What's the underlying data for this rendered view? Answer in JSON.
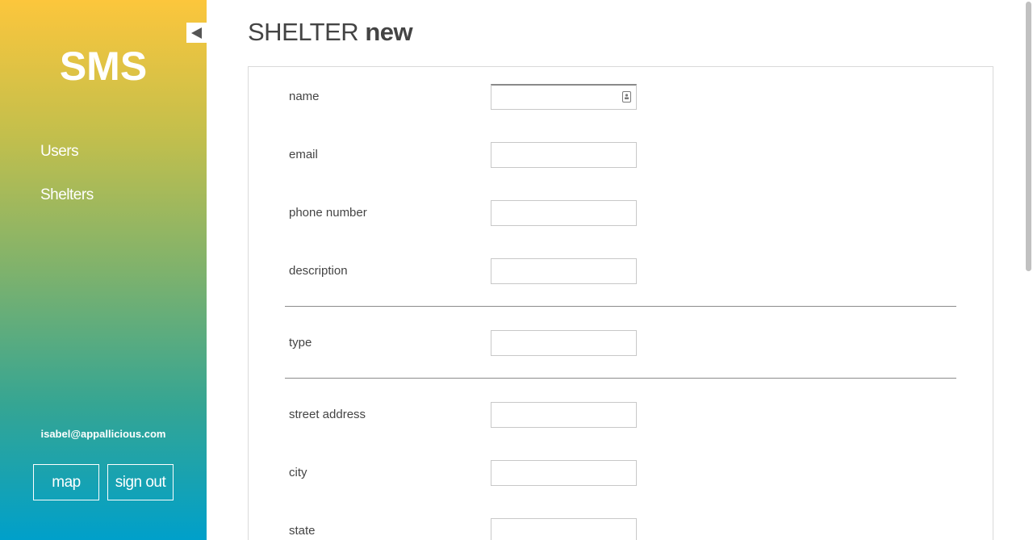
{
  "sidebar": {
    "brand": "SMS",
    "nav": [
      {
        "label": "Users"
      },
      {
        "label": "Shelters"
      }
    ],
    "user_email": "isabel@appallicious.com",
    "buttons": {
      "map_label": "map",
      "sign_out_label": "sign out"
    },
    "collapse_icon": "triangle-left-icon"
  },
  "header": {
    "title_prefix": "SHELTER",
    "title_suffix": "new"
  },
  "form": {
    "fields": [
      {
        "label": "name",
        "value": ""
      },
      {
        "label": "email",
        "value": ""
      },
      {
        "label": "phone number",
        "value": ""
      },
      {
        "label": "description",
        "value": ""
      },
      {
        "label": "type",
        "value": ""
      },
      {
        "label": "street address",
        "value": ""
      },
      {
        "label": "city",
        "value": ""
      },
      {
        "label": "state",
        "value": ""
      }
    ],
    "name_field_icon": "contact-card-icon"
  },
  "colors": {
    "gradient_top": "#fcc63c",
    "gradient_bottom": "#00a0ca",
    "text": "#444444",
    "divider": "#8c8c8c"
  }
}
